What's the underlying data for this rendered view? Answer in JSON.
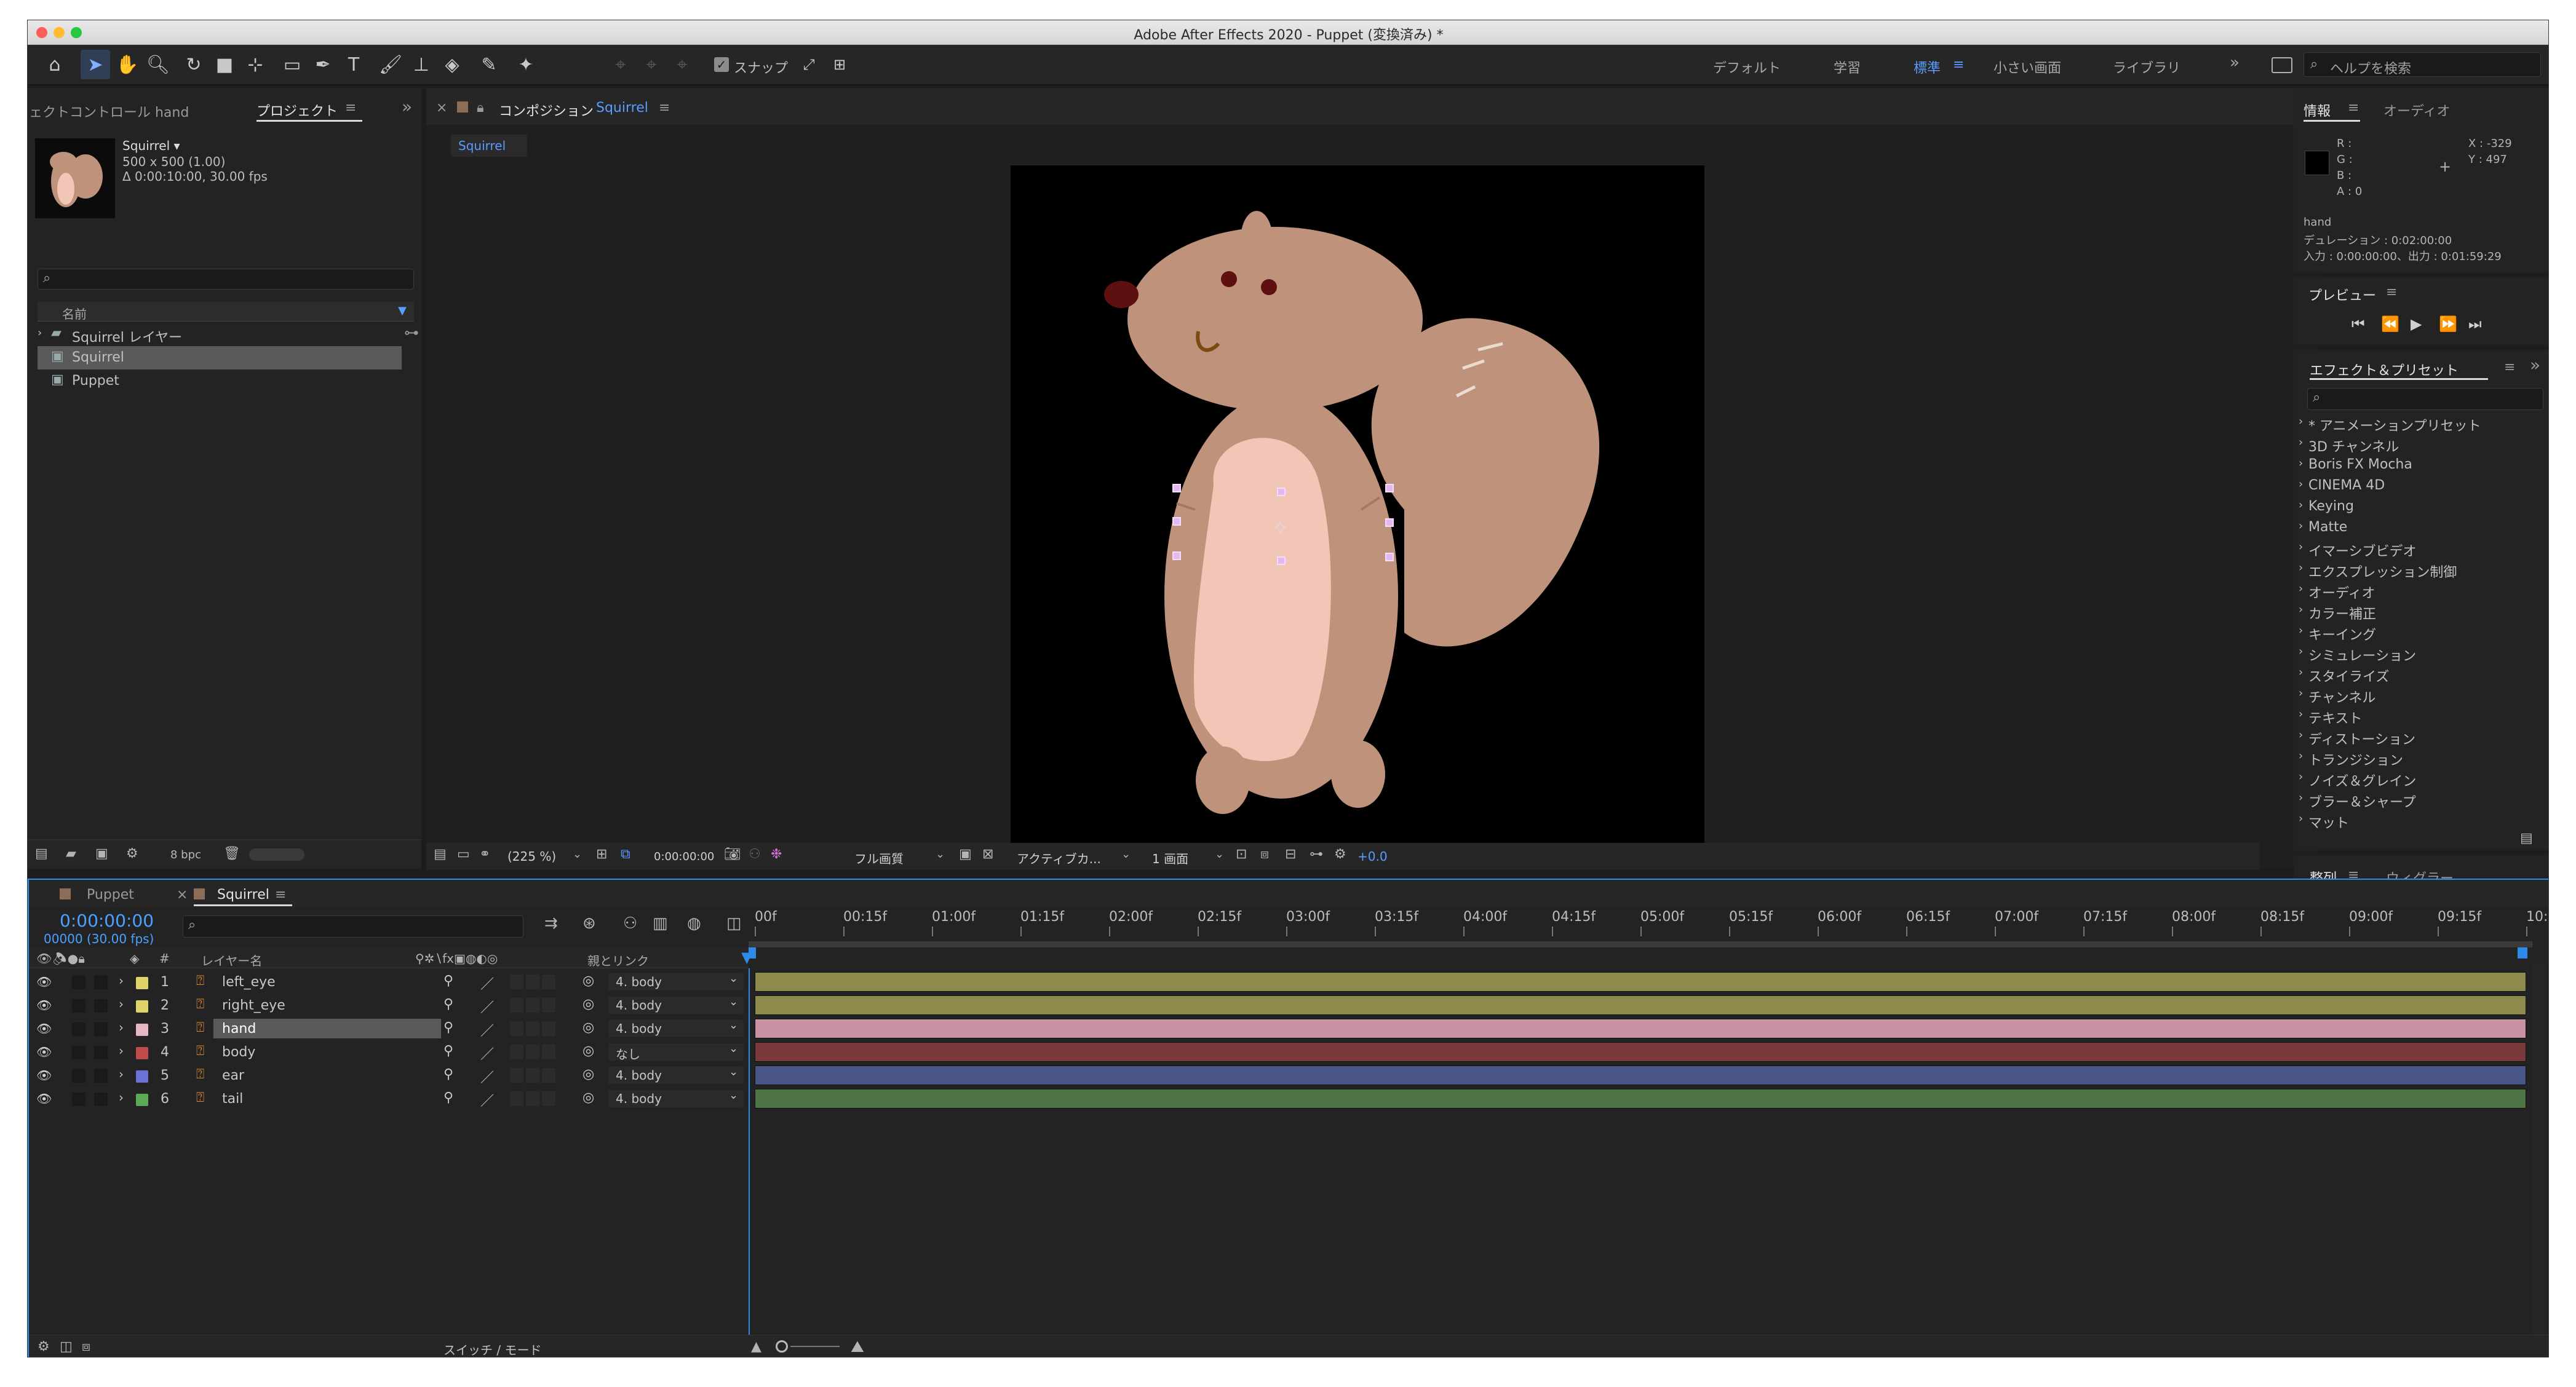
{
  "window": {
    "title": "Adobe After Effects 2020 - Puppet (変換済み) *"
  },
  "toolbar": {
    "snap_label": "スナップ",
    "workspaces": [
      "デフォルト",
      "学習",
      "標準",
      "小さい画面",
      "ライブラリ"
    ],
    "active_workspace": "標準",
    "help_search_placeholder": "ヘルプを検索"
  },
  "project_panel": {
    "tab_effects": "ェクトコントロール hand",
    "tab_project": "プロジェクト",
    "item_name": "Squirrel ▾",
    "item_info1": "500 x 500 (1.00)",
    "item_info2": "Δ 0:00:10:00, 30.00 fps",
    "column_name": "名前",
    "items": [
      {
        "label": "Squirrel レイヤー",
        "type": "folder",
        "selected": false
      },
      {
        "label": "Squirrel",
        "type": "comp",
        "selected": true
      },
      {
        "label": "Puppet",
        "type": "comp",
        "selected": false
      }
    ],
    "bpc": "8 bpc"
  },
  "composition_panel": {
    "tab_label": "コンポジション",
    "comp_name": "Squirrel",
    "sub_tab": "Squirrel",
    "zoom": "(225 %)",
    "timecode": "0:00:00:00",
    "resolution": "フル画質",
    "camera": "アクティブカ...",
    "views": "1 画面",
    "exposure": "+0.0"
  },
  "info_panel": {
    "tab_info": "情報",
    "tab_audio": "オーディオ",
    "r": "R :",
    "g": "G :",
    "b": "B :",
    "a": "A :  0",
    "x": "X : -329",
    "y": "Y : 497",
    "layer": "hand",
    "duration": "デュレーション : 0:02:00:00",
    "inout": "入力 : 0:00:00:00、出力 : 0:01:59:29"
  },
  "preview_panel": {
    "title": "プレビュー"
  },
  "effects_panel": {
    "title": "エフェクト＆プリセット",
    "items": [
      "* アニメーションプリセット",
      "3D チャンネル",
      "Boris FX Mocha",
      "CINEMA 4D",
      "Keying",
      "Matte",
      "イマーシブビデオ",
      "エクスプレッション制御",
      "オーディオ",
      "カラー補正",
      "キーイング",
      "シミュレーション",
      "スタイライズ",
      "チャンネル",
      "テキスト",
      "ディストーション",
      "トランジション",
      "ノイズ＆グレイン",
      "ブラー＆シャープ",
      "マット"
    ]
  },
  "align_panel": {
    "tab_align": "整列",
    "tab_wiggler": "ウィグラー"
  },
  "timeline": {
    "tab_puppet": "Puppet",
    "tab_squirrel": "Squirrel",
    "timecode": "0:00:00:00",
    "frames": "00000 (30.00 fps)",
    "col_layer_name": "レイヤー名",
    "col_parent": "親とリンク",
    "switch_mode": "スイッチ / モード",
    "ruler": [
      "00f",
      "00:15f",
      "01:00f",
      "01:15f",
      "02:00f",
      "02:15f",
      "03:00f",
      "03:15f",
      "04:00f",
      "04:15f",
      "05:00f",
      "05:15f",
      "06:00f",
      "06:15f",
      "07:00f",
      "07:15f",
      "08:00f",
      "08:15f",
      "09:00f",
      "09:15f",
      "10:0"
    ],
    "layers": [
      {
        "num": "1",
        "name": "left_eye",
        "parent": "4. body",
        "label_color": "#e0d36a",
        "bar_color": "#8d8a4c",
        "selected": false
      },
      {
        "num": "2",
        "name": "right_eye",
        "parent": "4. body",
        "label_color": "#e0d36a",
        "bar_color": "#8d8a4c",
        "selected": false
      },
      {
        "num": "3",
        "name": "hand",
        "parent": "4. body",
        "label_color": "#e7b8c4",
        "bar_color": "#c792a6",
        "selected": true
      },
      {
        "num": "4",
        "name": "body",
        "parent": "なし",
        "label_color": "#c24a4a",
        "bar_color": "#7a3a3c",
        "selected": false
      },
      {
        "num": "5",
        "name": "ear",
        "parent": "4. body",
        "label_color": "#6a72d8",
        "bar_color": "#4a5588",
        "selected": false
      },
      {
        "num": "6",
        "name": "tail",
        "parent": "4. body",
        "label_color": "#5caa55",
        "bar_color": "#4e7345",
        "selected": false
      }
    ]
  },
  "colors": {
    "accent": "#2d8ceb",
    "selected_workspace": "#5a9cff",
    "squirrel_body": "#bf927b",
    "squirrel_belly": "#f2c6b6"
  }
}
